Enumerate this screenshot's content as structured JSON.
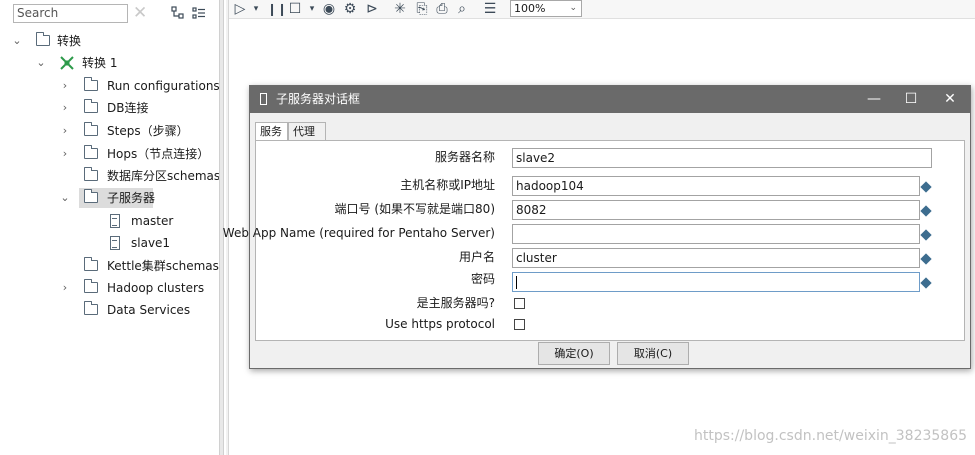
{
  "sidebar": {
    "search_placeholder": "Search",
    "tree": {
      "root": "转换",
      "transformation": "转换 1",
      "items": [
        {
          "label": "Run configurations"
        },
        {
          "label": "DB连接"
        },
        {
          "label": "Steps（步骤）"
        },
        {
          "label": "Hops（节点连接）"
        },
        {
          "label": "数据库分区schemas"
        },
        {
          "label": "子服务器"
        },
        {
          "label": "Kettle集群schemas"
        },
        {
          "label": "Hadoop clusters"
        },
        {
          "label": "Data Services"
        }
      ],
      "slave_servers": [
        "master",
        "slave1"
      ]
    }
  },
  "toolbar": {
    "zoom": "100%"
  },
  "dialog": {
    "title": "子服务器对话框",
    "tabs": [
      "服务",
      "代理"
    ],
    "fields": {
      "server_name_label": "服务器名称",
      "server_name_value": "slave2",
      "host_label": "主机名称或IP地址",
      "host_value": "hadoop104",
      "port_label": "端口号 (如果不写就是端口80)",
      "port_value": "8082",
      "webapp_label": "Web App Name (required for Pentaho Server)",
      "webapp_value": "",
      "username_label": "用户名",
      "username_value": "cluster",
      "password_label": "密码",
      "password_value": "",
      "master_label": "是主服务器吗?",
      "https_label": "Use https protocol"
    },
    "ok_label": "确定(O)",
    "cancel_label": "取消(C)"
  },
  "watermark": "https://blog.csdn.net/weixin_38235865",
  "colors": {
    "titlebar": "#6a6a6a",
    "selected_row": "#dcdcdc",
    "diamond_icon": "#3d6d8f"
  }
}
